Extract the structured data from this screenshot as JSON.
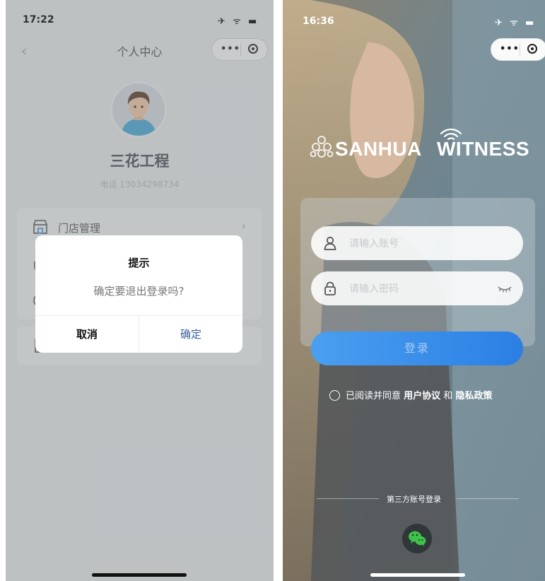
{
  "left_screen": {
    "status_time": "17:22",
    "nav_title": "个人中心",
    "capsule_more": "•••",
    "profile_name": "三花工程",
    "profile_phone": "电话 13034298734",
    "menu_items": [
      {
        "label": "门店管理",
        "icon": "store-icon"
      }
    ],
    "dialog": {
      "title": "提示",
      "message": "确定要退出登录吗?",
      "cancel_label": "取消",
      "confirm_label": "确定",
      "confirm_color": "#3a5f9e"
    }
  },
  "right_screen": {
    "status_time": "16:36",
    "capsule_more": "•••",
    "brand_left": "SANHUA",
    "brand_right": "WITNESS",
    "account_placeholder": "请输入账号",
    "password_placeholder": "请输入密码",
    "login_label": "登录",
    "agree_prefix": "已阅读并同意",
    "agree_terms": "用户协议",
    "agree_and": "和",
    "agree_privacy": "隐私政策",
    "third_party_label": "第三方账号登录",
    "login_button_color": "#2b7fe4"
  }
}
